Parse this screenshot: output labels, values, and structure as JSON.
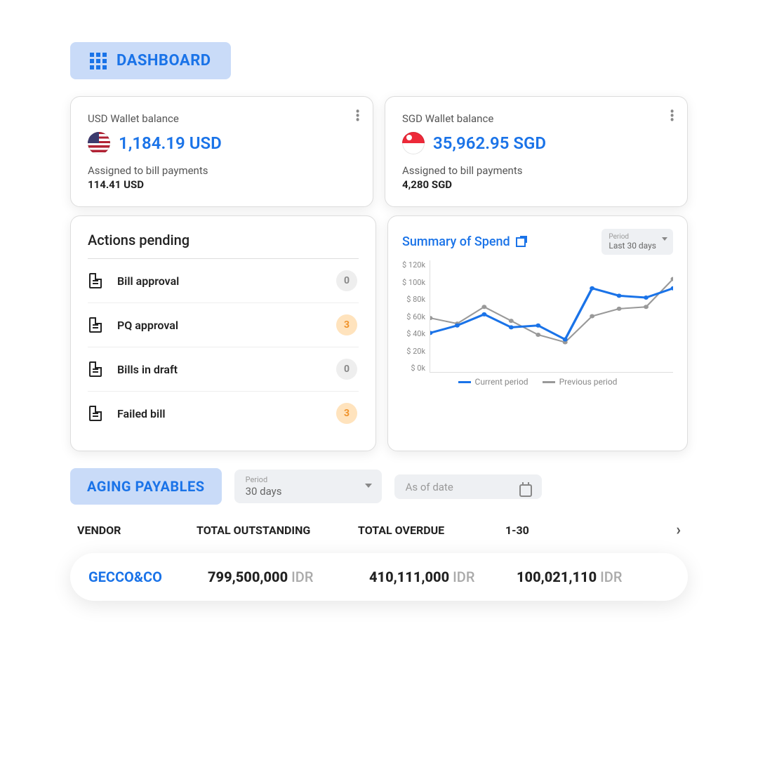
{
  "header": {
    "title": "DASHBOARD"
  },
  "wallets": [
    {
      "title": "USD Wallet balance",
      "flag": "us",
      "balance": "1,184.19 USD",
      "assigned_label": "Assigned to bill payments",
      "assigned_value": "114.41 USD"
    },
    {
      "title": "SGD Wallet balance",
      "flag": "sg",
      "balance": "35,962.95 SGD",
      "assigned_label": "Assigned to bill payments",
      "assigned_value": "4,280 SGD"
    }
  ],
  "actions": {
    "title": "Actions pending",
    "items": [
      {
        "label": "Bill approval",
        "count": 0,
        "style": "gray"
      },
      {
        "label": "PQ approval",
        "count": 3,
        "style": "orange"
      },
      {
        "label": "Bills in draft",
        "count": 0,
        "style": "gray"
      },
      {
        "label": "Failed bill",
        "count": 3,
        "style": "orange"
      }
    ]
  },
  "spend": {
    "title": "Summary of Spend",
    "period_label": "Period",
    "period_value": "Last 30 days",
    "legend_current": "Current period",
    "legend_previous": "Previous period"
  },
  "chart_data": {
    "type": "line",
    "ylabel": "$",
    "ylim": [
      0,
      120
    ],
    "yticks": [
      "$ 120k",
      "$ 100k",
      "$ 80k",
      "$ 60k",
      "$ 40k",
      "$ 20k",
      "$ 0k"
    ],
    "x": [
      0,
      1,
      2,
      3,
      4,
      5,
      6,
      7,
      8,
      9
    ],
    "series": [
      {
        "name": "Current period",
        "color": "#1a73e8",
        "values": [
          42,
          50,
          62,
          48,
          50,
          35,
          90,
          82,
          80,
          90
        ]
      },
      {
        "name": "Previous period",
        "color": "#999999",
        "values": [
          58,
          52,
          70,
          55,
          40,
          32,
          60,
          68,
          70,
          100
        ]
      }
    ]
  },
  "aging": {
    "title": "AGING PAYABLES",
    "period_label": "Period",
    "period_value": "30 days",
    "asof_placeholder": "As of date",
    "columns": {
      "vendor": "VENDOR",
      "outstanding": "TOTAL OUTSTANDING",
      "overdue": "TOTAL OVERDUE",
      "range1": "1-30"
    },
    "rows": [
      {
        "vendor": "GECCO&CO",
        "outstanding": "799,500,000",
        "overdue": "410,111,000",
        "range1": "100,021,110",
        "currency": "IDR"
      }
    ]
  }
}
